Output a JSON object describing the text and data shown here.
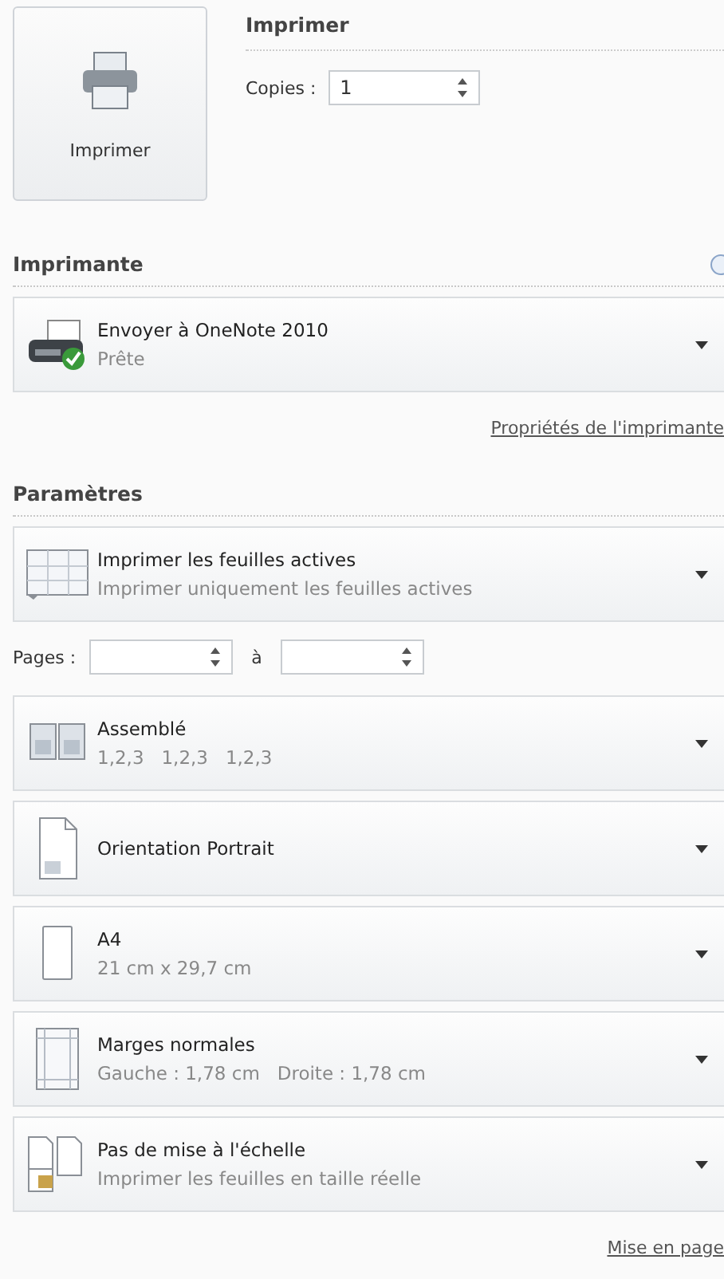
{
  "print_button": {
    "label": "Imprimer"
  },
  "print_section": {
    "title": "Imprimer",
    "copies_label": "Copies :",
    "copies_value": "1"
  },
  "printer_section": {
    "title": "Imprimante",
    "printer": {
      "name": "Envoyer à OneNote 2010",
      "status": "Prête",
      "ready": true
    },
    "properties_link": "Propriétés de l'imprimante"
  },
  "settings_section": {
    "title": "Paramètres",
    "options": [
      {
        "kind": "sheets",
        "title": "Imprimer les feuilles actives",
        "subtitle": "Imprimer uniquement les feuilles actives"
      },
      {
        "kind": "pages",
        "label": "Pages :",
        "to_label": "à"
      },
      {
        "kind": "collate",
        "title": "Assemblé",
        "subtitle": "1,2,3   1,2,3   1,2,3"
      },
      {
        "kind": "orientation",
        "title": "Orientation Portrait"
      },
      {
        "kind": "paper",
        "title": "A4",
        "subtitle": "21 cm x 29,7 cm"
      },
      {
        "kind": "margins",
        "title": "Marges normales",
        "subtitle": "Gauche : 1,78 cm   Droite : 1,78 cm"
      },
      {
        "kind": "scaling",
        "title": "Pas de mise à l'échelle",
        "subtitle": "Imprimer les feuilles en taille réelle"
      }
    ],
    "page_setup_link": "Mise en page"
  }
}
